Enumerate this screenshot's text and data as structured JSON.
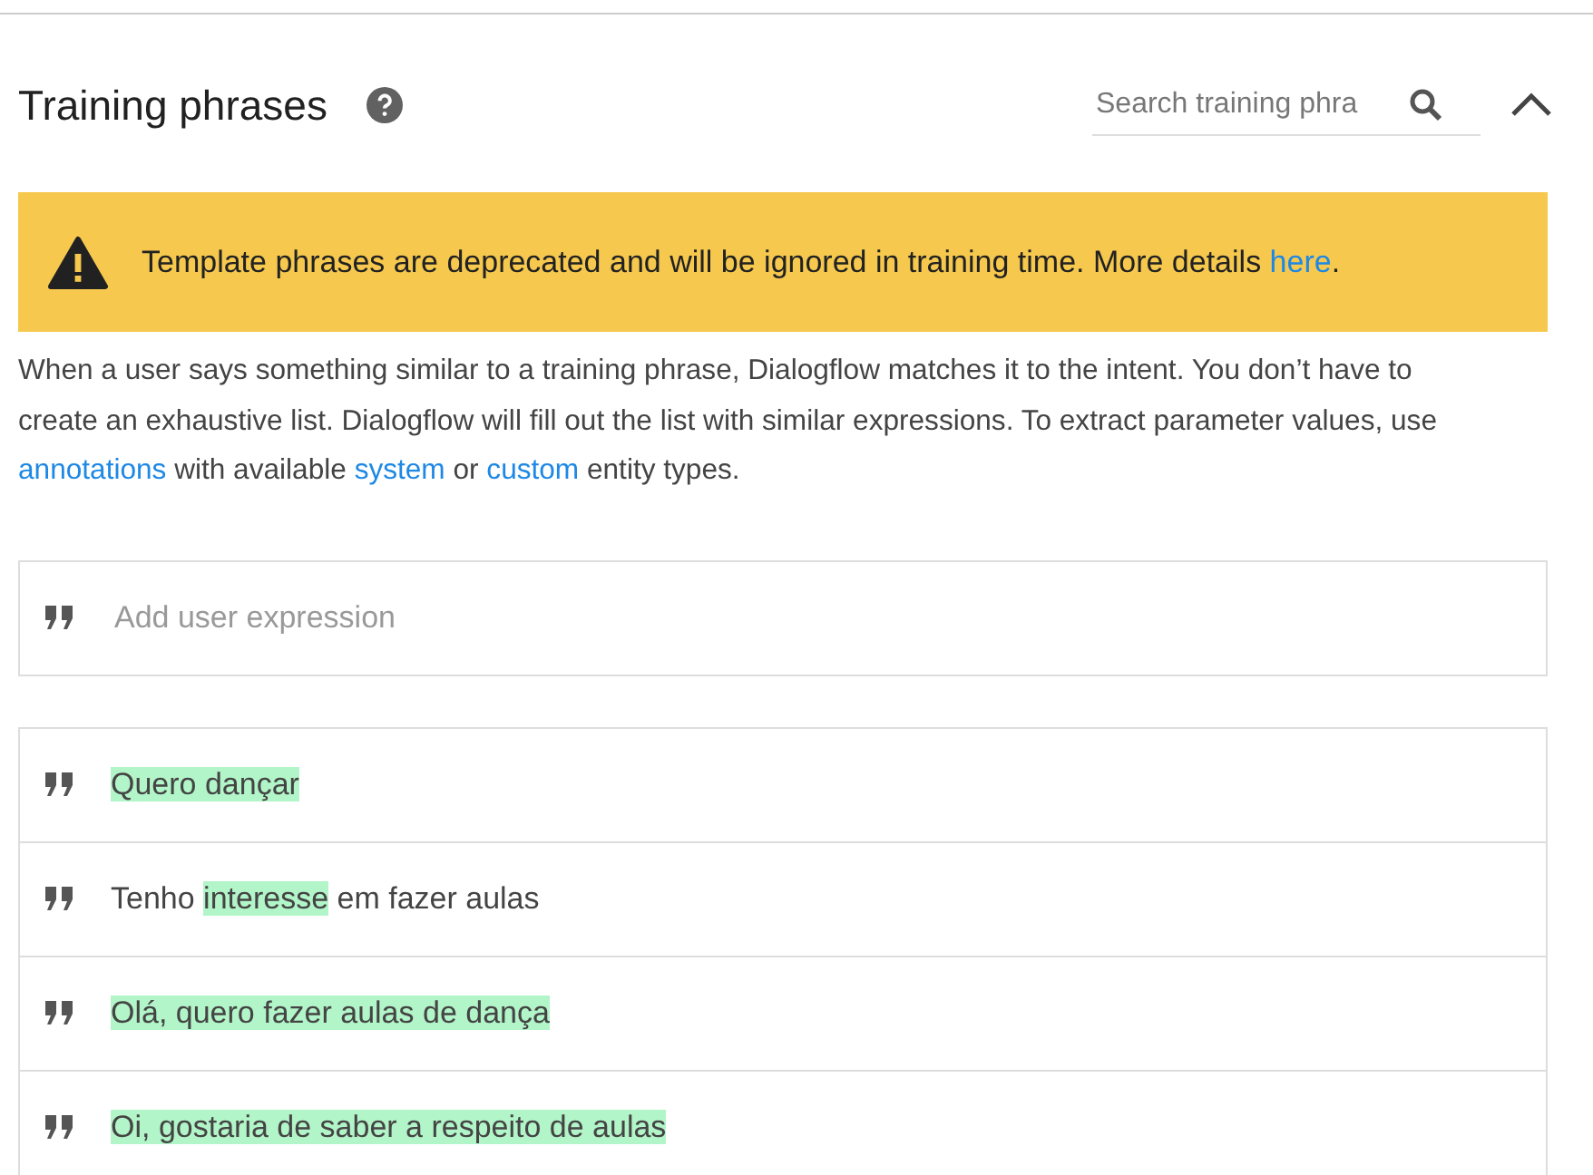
{
  "section": {
    "title": "Training phrases",
    "expanded": true
  },
  "search": {
    "placeholder": "Search training phra"
  },
  "warning": {
    "segments": [
      {
        "kind": "text",
        "text": "Template phrases are deprecated and will be ignored in training time. More details "
      },
      {
        "kind": "link",
        "text": "here"
      },
      {
        "kind": "text",
        "text": "."
      }
    ]
  },
  "description": {
    "segments": [
      {
        "kind": "text",
        "text": "When a user says something similar to a training phrase, Dialogflow matches it to the intent. You don’t have to create an exhaustive list. Dialogflow will fill out the list with similar expressions. To extract parameter values, use "
      },
      {
        "kind": "link",
        "text": "annotations"
      },
      {
        "kind": "text",
        "text": " with available "
      },
      {
        "kind": "link",
        "text": "system"
      },
      {
        "kind": "text",
        "text": " or "
      },
      {
        "kind": "link",
        "text": "custom"
      },
      {
        "kind": "text",
        "text": " entity types."
      }
    ]
  },
  "new_phrase": {
    "placeholder": "Add user expression"
  },
  "phrases": [
    {
      "segments": [
        {
          "text": "Quero dançar",
          "annotated": true
        }
      ]
    },
    {
      "segments": [
        {
          "text": "Tenho ",
          "annotated": false
        },
        {
          "text": "interesse",
          "annotated": true
        },
        {
          "text": " em fazer aulas",
          "annotated": false
        }
      ]
    },
    {
      "segments": [
        {
          "text": "Olá, quero fazer aulas de dança",
          "annotated": true
        }
      ]
    },
    {
      "segments": [
        {
          "text": "Oi, gostaria de saber a respeito de aulas",
          "annotated": true
        }
      ]
    }
  ]
}
